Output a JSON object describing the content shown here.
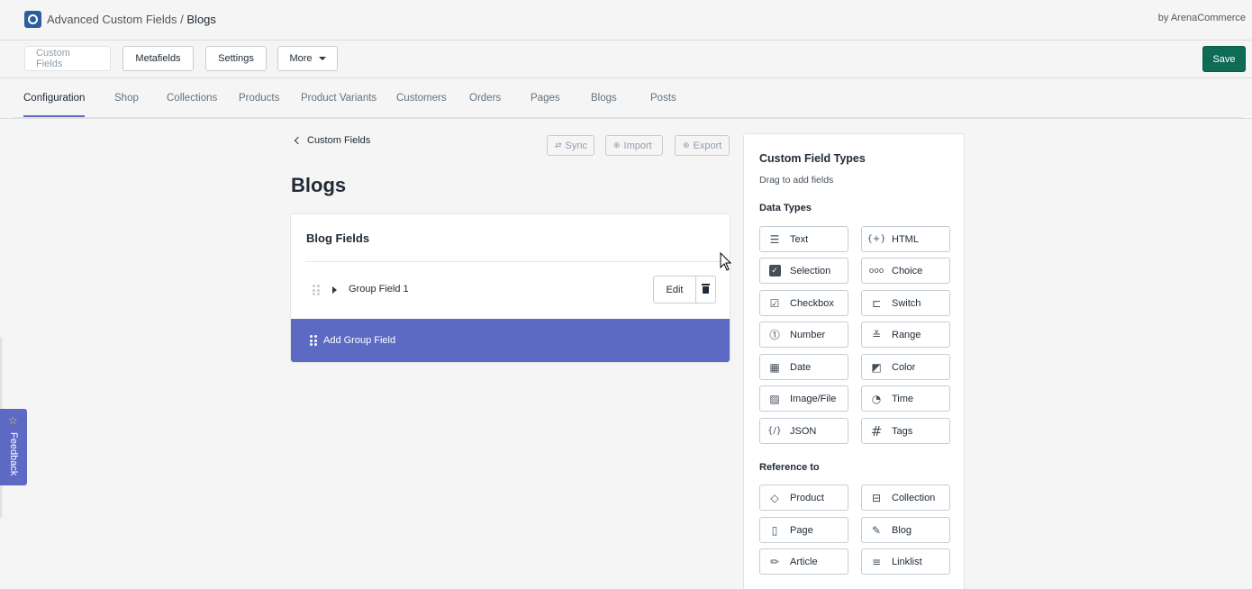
{
  "header": {
    "app_name": "Advanced Custom Fields",
    "separator": "/",
    "page": "Blogs",
    "byline": "by ArenaCommerce"
  },
  "toolbar": {
    "custom_fields": "Custom Fields",
    "metafields": "Metafields",
    "settings": "Settings",
    "more": "More",
    "save": "Save"
  },
  "nav": {
    "tabs": [
      "Configuration",
      "Shop",
      "Collections",
      "Products",
      "Product Variants",
      "Customers",
      "Orders",
      "Pages",
      "Blogs",
      "Posts"
    ],
    "active": "Configuration"
  },
  "main": {
    "back_label": "Custom Fields",
    "sync": "Sync",
    "import": "Import",
    "export": "Export",
    "title": "Blogs",
    "card_title": "Blog Fields",
    "group_field": "Group Field 1",
    "edit": "Edit",
    "add_group": "Add Group Field"
  },
  "sidebar": {
    "title": "Custom Field Types",
    "subtitle": "Drag to add fields",
    "data_types_heading": "Data Types",
    "data_types": [
      {
        "label": "Text",
        "icon": "text-icon"
      },
      {
        "label": "HTML",
        "icon": "html-icon"
      },
      {
        "label": "Selection",
        "icon": "checkbox-checked-icon"
      },
      {
        "label": "Choice",
        "icon": "choice-icon"
      },
      {
        "label": "Checkbox",
        "icon": "clipboard-check-icon"
      },
      {
        "label": "Switch",
        "icon": "switch-icon"
      },
      {
        "label": "Number",
        "icon": "number-icon"
      },
      {
        "label": "Range",
        "icon": "range-icon"
      },
      {
        "label": "Date",
        "icon": "calendar-icon"
      },
      {
        "label": "Color",
        "icon": "color-icon"
      },
      {
        "label": "Image/File",
        "icon": "image-icon"
      },
      {
        "label": "Time",
        "icon": "time-icon"
      },
      {
        "label": "JSON",
        "icon": "json-icon"
      },
      {
        "label": "Tags",
        "icon": "hash-icon"
      }
    ],
    "reference_heading": "Reference to",
    "reference_types": [
      {
        "label": "Product",
        "icon": "tag-icon"
      },
      {
        "label": "Collection",
        "icon": "collection-icon"
      },
      {
        "label": "Page",
        "icon": "page-icon"
      },
      {
        "label": "Blog",
        "icon": "blog-edit-icon"
      },
      {
        "label": "Article",
        "icon": "pencil-icon"
      },
      {
        "label": "Linklist",
        "icon": "list-icon"
      }
    ]
  },
  "feedback": {
    "label": "Feedback"
  },
  "colors": {
    "accent": "#5c6ac4",
    "save": "#0e6b56"
  }
}
